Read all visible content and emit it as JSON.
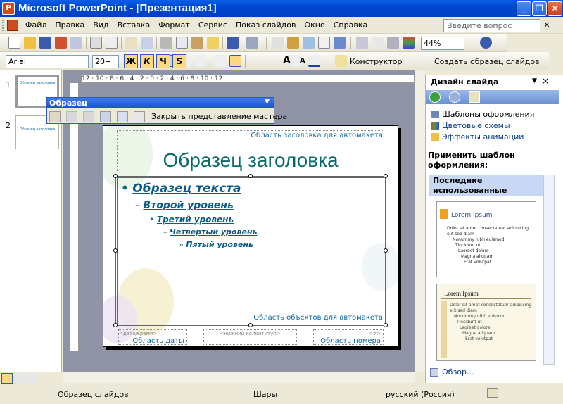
{
  "window": {
    "title": "Microsoft PowerPoint - [Презентация1]",
    "app_icon": "P",
    "min": "_",
    "max": "❐",
    "close": "✕"
  },
  "menubar": {
    "items": [
      "Файл",
      "Правка",
      "Вид",
      "Вставка",
      "Формат",
      "Сервис",
      "Показ слайдов",
      "Окно",
      "Справка"
    ],
    "help_placeholder": "Введите вопрос",
    "close": "×"
  },
  "toolbar_standard": {
    "zoom": "44%"
  },
  "toolbar_format": {
    "font": "Arial",
    "size": "20+",
    "bold": "Ж",
    "italic": "К",
    "underline": "Ч",
    "shadow": "S",
    "increase_font": "A",
    "decrease_font": "A",
    "designer_label": "Конструктор",
    "new_master_label": "Создать образец слайдов"
  },
  "thumbnails": [
    {
      "num": "1",
      "text": "Образец заголовка"
    },
    {
      "num": "2",
      "text": "Образец заголовка"
    }
  ],
  "ruler": {
    "h_ticks": "12 · 10 · 8 · 6 · 4 · 2 · 0 · 2 · 4 · 6 · 8 · 10 · 12"
  },
  "master_toolbar": {
    "title": "Образец",
    "close_label": "Закрыть представление мастера"
  },
  "slide": {
    "title_area_label": "Область заголовка для автомакета",
    "title": "Образец заголовка",
    "levels": [
      "Образец текста",
      "Второй уровень",
      "Третий уровень",
      "Четвертый уровень",
      "Пятый уровень"
    ],
    "bullets": [
      "•",
      "–",
      "•",
      "–",
      "»"
    ],
    "object_area_label": "Область объектов для автомакета",
    "footer": {
      "date_tag": "<дата/время>",
      "date_label": "Область даты",
      "footer_tag": "<нижний колонтитул>",
      "number_tag": "<#>",
      "number_label": "Область номера"
    }
  },
  "task_pane": {
    "title": "Дизайн слайда",
    "links": [
      "Шаблоны оформления",
      "Цветовые схемы",
      "Эффекты анимации"
    ],
    "apply_label": "Применить шаблон оформления:",
    "recent_header": "Последние использованные",
    "template1_title": "Lorem Ipsum",
    "template1_lines": [
      "Dolor sit amet consectetuer adipiscing elit sed diam",
      "Nonummy nibh euismod",
      "Tincidunt ut",
      "Laoreet dolore",
      "Magna aliquam",
      "Erat volutpat"
    ],
    "template2_title": "Lorem Ipsum",
    "template2_lines": [
      "Dolor sit amet consectetuer adipiscing elit sed diam",
      "Nonummy nibh euismod",
      "Tincidunt ut",
      "Laoreet dolore",
      "Magna aliquam",
      "Erat volutpat"
    ],
    "browse": "Обзор..."
  },
  "status": {
    "view": "Образец слайдов",
    "design": "Шары",
    "language": "русский (Россия)"
  }
}
